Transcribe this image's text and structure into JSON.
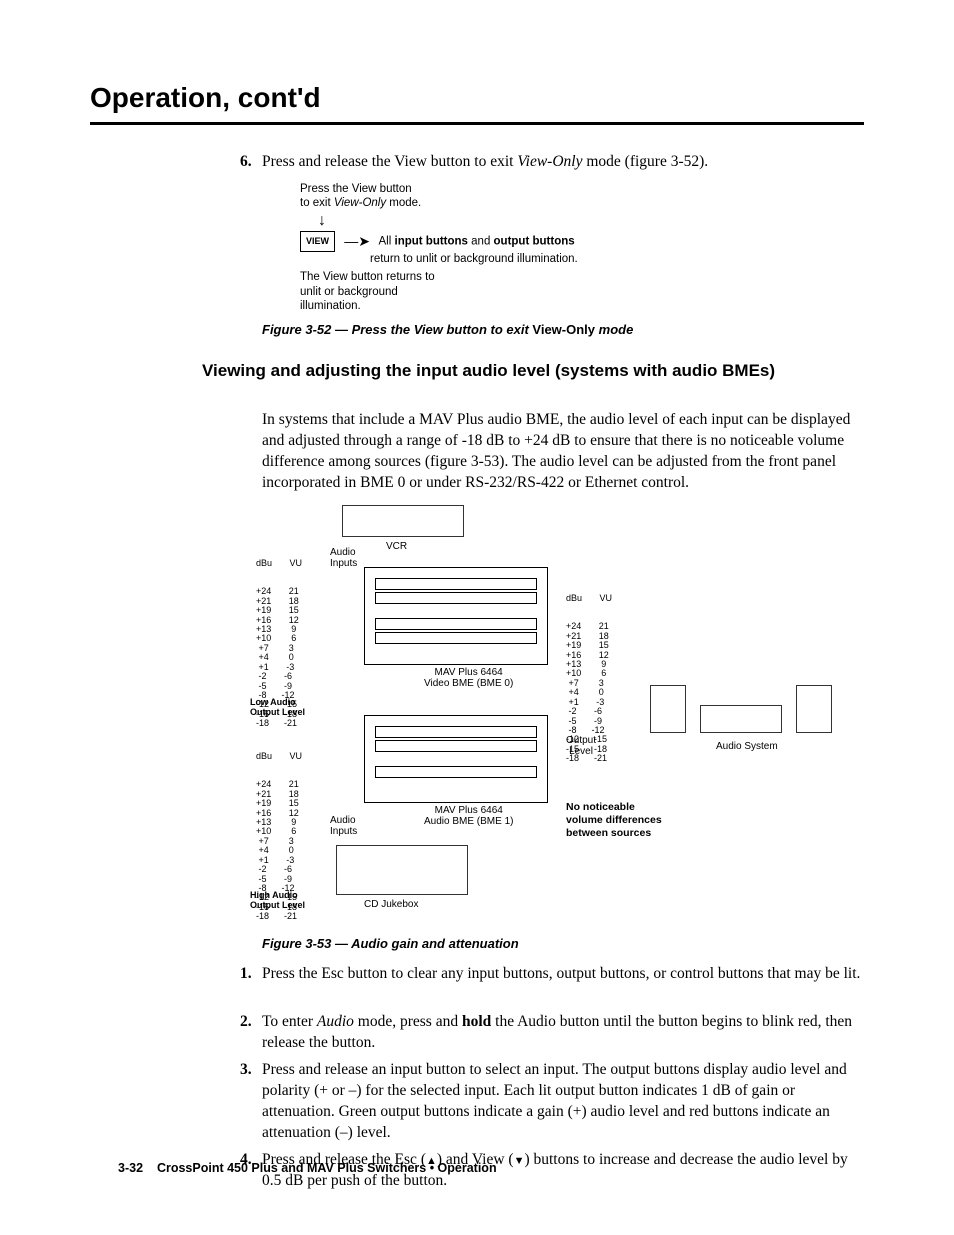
{
  "header": "Operation, cont'd",
  "step6": {
    "num": "6.",
    "pre": "Press and release the View button to exit ",
    "mode": "View-Only",
    "post": " mode (figure 3-52)."
  },
  "fig52": {
    "press1": "Press the View button",
    "press2_pre": "to exit ",
    "press2_mode": "View-Only",
    "press2_post": " mode.",
    "view_label": "VIEW",
    "right_pre": "All ",
    "right_b1": "input buttons",
    "right_mid": " and ",
    "right_b2": "output buttons",
    "right_line2": "return to unlit or background illumination.",
    "below1": "The View button returns to",
    "below2": "unlit or background",
    "below3": "illumination.",
    "caption_pre": "Figure 3-52 — Press the View button to exit ",
    "caption_nv": "View-Only",
    "caption_post": " mode"
  },
  "section_title": "Viewing and adjusting the input audio level (systems with audio BMEs)",
  "intro": "In systems that include a MAV Plus audio BME, the audio level of each input can be displayed and adjusted through a range of -18 dB to +24 dB to ensure that there is no noticeable volume difference among sources (figure 3-53).  The audio level can be adjusted from the front panel incorporated in BME 0 or under RS-232/RS-422 or Ethernet control.",
  "fig53": {
    "dbu_vu_header": "dBu       VU",
    "scale": "+24       21\n+21       18\n+19       15\n+16       12\n+13        9\n+10        6\n +7        3\n +4        0\n +1       -3\n -2       -6\n -5       -9\n -8      -12\n-12      -15\n-15      -18\n-18      -21",
    "low_label": "Low Audio\nOutput Level",
    "high_label": "High Audio\nOutput Level",
    "output_level": "Output\nLevel",
    "audio_inputs": "Audio\nInputs",
    "vcr": "VCR",
    "rack_video": "MAV Plus 6464\nVideo BME (BME 0)",
    "rack_audio": "MAV Plus 6464\nAudio BME (BME 1)",
    "cd": "CD Jukebox",
    "no_notice": "No noticeable\nvolume differences\nbetween sources",
    "audio_system": "Audio System",
    "caption": "Figure 3-53 — Audio gain and attenuation"
  },
  "steps": {
    "s1": {
      "num": "1.",
      "text": "Press the Esc button to clear any input buttons, output buttons, or control buttons that may be lit."
    },
    "s2": {
      "num": "2.",
      "pre": "To enter ",
      "audio": "Audio",
      "mid": " mode, press and ",
      "hold": "hold",
      "post": " the Audio button until the button begins to blink red, then release the button."
    },
    "s3": {
      "num": "3.",
      "text": "Press and release an input button to select an input.  The output buttons display audio level and polarity (+ or –) for the selected input.  Each lit output button indicates 1 dB of gain or attenuation.  Green output buttons indicate a gain (+) audio level and red buttons indicate an attenuation (–) level."
    },
    "s4": {
      "num": "4.",
      "pre": "Press and release the Esc (",
      "up": "▲",
      "mid": ") and View (",
      "down": "▼",
      "post": ") buttons to increase and decrease the audio level by 0.5 dB per push of the button."
    }
  },
  "footer": {
    "page": "3-32",
    "text": "CrossPoint 450 Plus and MAV Plus Switchers • Operation"
  }
}
